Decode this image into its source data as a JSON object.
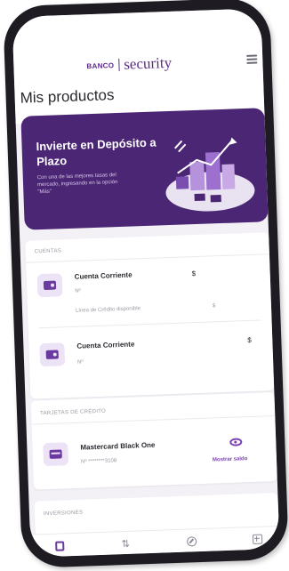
{
  "header": {
    "logo_banco": "BANCO",
    "logo_security": "security",
    "page_title": "Mis productos"
  },
  "banner": {
    "title": "Invierte en Depósito a Plazo",
    "text": "Con una de las mejores tasas del mercado, ingresando en la opción \"Más\""
  },
  "cuentas": {
    "section_label": "CUENTAS",
    "items": [
      {
        "name": "Cuenta Corriente",
        "number": "Nº",
        "amount": "$",
        "credit_label": "Línea de Crédito disponible",
        "credit_amount": "$"
      },
      {
        "name": "Cuenta Corriente",
        "number": "Nº",
        "amount": "$"
      }
    ]
  },
  "tarjetas": {
    "section_label": "TARJETAS DE CRÉDITO",
    "items": [
      {
        "name": "Mastercard Black One",
        "number": "Nº ********3108",
        "action": "Mostrar saldo"
      }
    ]
  },
  "inversiones": {
    "section_label": "INVERSIONES"
  },
  "icons": {
    "menu": "hamburger-menu-icon",
    "account": "wallet-icon",
    "card": "credit-card-icon",
    "eye": "eye-icon",
    "nav": [
      "products-icon",
      "transfer-arrows-icon",
      "payments-icon",
      "more-plus-icon"
    ]
  },
  "colors": {
    "brand_purple": "#5b2a86",
    "banner_bg": "#4b2674",
    "accent": "#7b3fb2"
  }
}
